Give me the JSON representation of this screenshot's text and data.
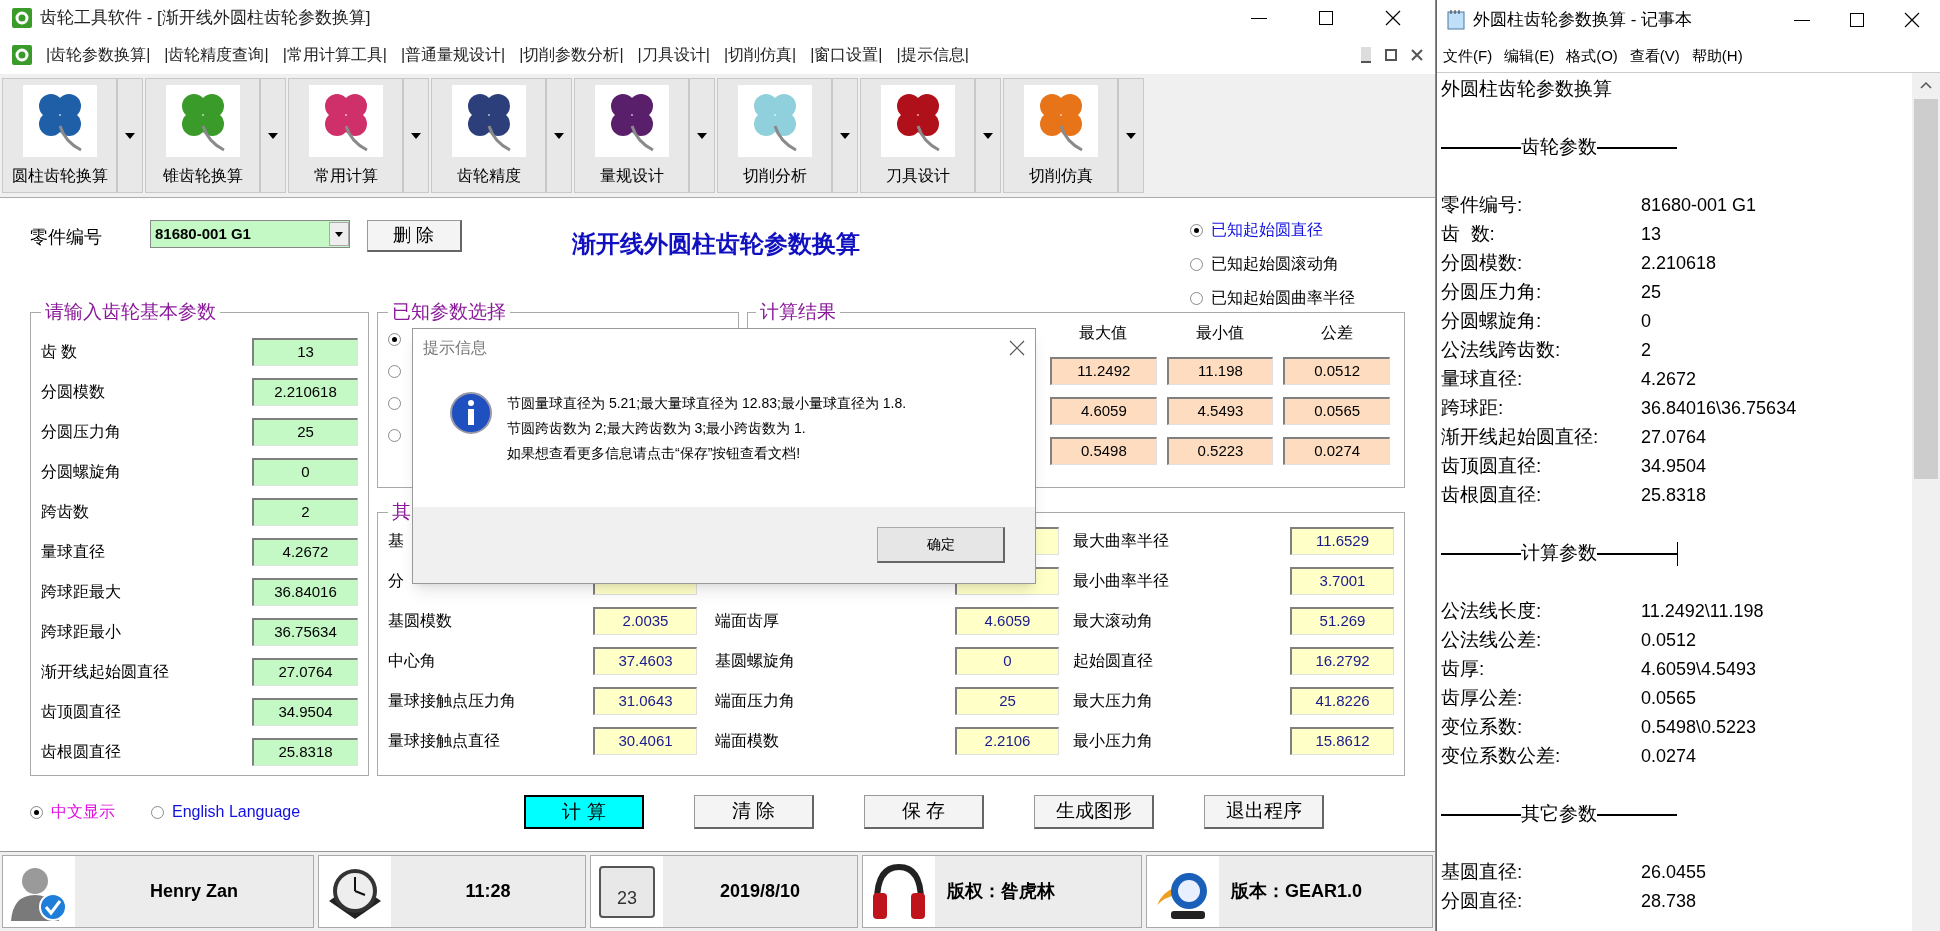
{
  "main_window": {
    "title": "齿轮工具软件 - [渐开线外圆柱齿轮参数换算]"
  },
  "menu": [
    "|齿轮参数换算|",
    "|齿轮精度查询|",
    "|常用计算工具|",
    "|普通量规设计|",
    "|切削参数分析|",
    "|刀具设计|",
    "|切削仿真|",
    "|窗口设置|",
    "|提示信息|"
  ],
  "toolbar": [
    {
      "label": "圆柱齿轮换算",
      "color": "#1f5fa8"
    },
    {
      "label": "锥齿轮换算",
      "color": "#3a9a2a"
    },
    {
      "label": "常用计算",
      "color": "#d0306a"
    },
    {
      "label": "齿轮精度",
      "color": "#2d3f7a"
    },
    {
      "label": "量规设计",
      "color": "#5a1f6a"
    },
    {
      "label": "切削分析",
      "color": "#8fd0dc"
    },
    {
      "label": "刀具设计",
      "color": "#b0101a"
    },
    {
      "label": "切削仿真",
      "color": "#e8741a"
    }
  ],
  "form": {
    "part_no_label": "零件编号",
    "part_no": "81680-001 G1",
    "delete_button": "删 除",
    "title": "渐开线外圆柱齿轮参数换算",
    "modes": [
      {
        "label": "已知起始圆直径",
        "selected": true
      },
      {
        "label": "已知起始圆滚动角",
        "selected": false
      },
      {
        "label": "已知起始圆曲率半径",
        "selected": false
      }
    ]
  },
  "basic": {
    "title": "请输入齿轮基本参数",
    "rows": [
      {
        "label": "齿 数",
        "value": "13"
      },
      {
        "label": "分圆模数",
        "value": "2.210618"
      },
      {
        "label": "分圆压力角",
        "value": "25"
      },
      {
        "label": "分圆螺旋角",
        "value": "0"
      },
      {
        "label": "跨齿数",
        "value": "2"
      },
      {
        "label": "量球直径",
        "value": "4.2672"
      },
      {
        "label": "跨球距最大",
        "value": "36.84016"
      },
      {
        "label": "跨球距最小",
        "value": "36.75634"
      },
      {
        "label": "渐开线起始圆直径",
        "value": "27.0764"
      },
      {
        "label": "齿顶圆直径",
        "value": "34.9504"
      },
      {
        "label": "齿根圆直径",
        "value": "25.8318"
      }
    ]
  },
  "known": {
    "title": "已知参数选择",
    "options": [
      {
        "selected": true
      },
      {
        "selected": false
      },
      {
        "selected": false
      },
      {
        "selected": false
      }
    ]
  },
  "results": {
    "title": "计算结果",
    "columns": [
      "最大值",
      "最小值",
      "公差"
    ],
    "rows": [
      [
        "11.2492",
        "11.198",
        "0.0512"
      ],
      [
        "4.6059",
        "4.5493",
        "0.0565"
      ],
      [
        "0.5498",
        "0.5223",
        "0.0274"
      ]
    ]
  },
  "other": {
    "title": "其",
    "rows": [
      {
        "label_1": "基",
        "label_3": "最大曲率半径",
        "value_3": "11.6529"
      },
      {
        "label_1": "分",
        "label_3": "最小曲率半径",
        "value_3": "3.7001"
      },
      {
        "label_1": "基圆模数",
        "value_1": "2.0035",
        "label_2": "端面齿厚",
        "value_2": "4.6059",
        "label_3": "最大滚动角",
        "value_3": "51.269"
      },
      {
        "label_1": "中心角",
        "value_1": "37.4603",
        "label_2": "基圆螺旋角",
        "value_2": "0",
        "label_3": "起始圆直径",
        "value_3": "16.2792"
      },
      {
        "label_1": "量球接触点压力角",
        "value_1": "31.0643",
        "label_2": "端面压力角",
        "value_2": "25",
        "label_3": "最大压力角",
        "value_3": "41.8226"
      },
      {
        "label_1": "量球接触点直径",
        "value_1": "30.4061",
        "label_2": "端面模数",
        "value_2": "2.2106",
        "label_3": "最小压力角",
        "value_3": "15.8612"
      }
    ]
  },
  "language": [
    {
      "label": "中文显示",
      "selected": true
    },
    {
      "label": "English Language",
      "selected": false
    }
  ],
  "buttons": [
    {
      "label": "计 算",
      "focused": true
    },
    {
      "label": "清 除",
      "focused": false
    },
    {
      "label": "保 存",
      "focused": false
    },
    {
      "label": "生成图形",
      "focused": false
    },
    {
      "label": "退出程序",
      "focused": false
    }
  ],
  "dialog": {
    "title": "提示信息",
    "lines": [
      "节圆量球直径为 5.21;最大量球直径为 12.83;最小量球直径为 1.8.",
      "节圆跨齿数为 2;最大跨齿数为 3;最小跨齿数为 1.",
      "如果想查看更多信息请点击“保存”按钮查看文档!"
    ],
    "ok": "确定"
  },
  "status_bar": [
    {
      "kind": "user",
      "text": "Henry Zan"
    },
    {
      "kind": "clock",
      "text": "11:28"
    },
    {
      "kind": "calendar",
      "icon_text": "23",
      "text": "2019/8/10"
    },
    {
      "kind": "headphones",
      "text": "版权：昝虎林"
    },
    {
      "kind": "globe",
      "text": "版本：GEAR1.0"
    }
  ],
  "notepad": {
    "title": "外圆柱齿轮参数换算 - 记事本",
    "menu": [
      "文件(F)",
      "编辑(E)",
      "格式(O)",
      "查看(V)",
      "帮助(H)"
    ],
    "lines": [
      {
        "kind": "text",
        "text": "外圆柱齿轮参数换算"
      },
      {
        "kind": "blank"
      },
      {
        "kind": "heading",
        "text": "齿轮参数",
        "cursor": false
      },
      {
        "kind": "blank"
      },
      {
        "kind": "pair",
        "label": "零件编号:",
        "value": "81680-001 G1"
      },
      {
        "kind": "pair",
        "label": "齿  数:",
        "value": "13"
      },
      {
        "kind": "pair",
        "label": "分圆模数:",
        "value": "2.210618"
      },
      {
        "kind": "pair",
        "label": "分圆压力角:",
        "value": "25"
      },
      {
        "kind": "pair",
        "label": "分圆螺旋角:",
        "value": "0"
      },
      {
        "kind": "pair",
        "label": "公法线跨齿数:",
        "value": "2"
      },
      {
        "kind": "pair",
        "label": "量球直径:",
        "value": "4.2672"
      },
      {
        "kind": "pair",
        "label": "跨球距:",
        "value": "36.84016\\36.75634"
      },
      {
        "kind": "pair",
        "label": "渐开线起始圆直径:",
        "value": "27.0764"
      },
      {
        "kind": "pair",
        "label": "齿顶圆直径:",
        "value": "34.9504"
      },
      {
        "kind": "pair",
        "label": "齿根圆直径:",
        "value": "25.8318"
      },
      {
        "kind": "blank"
      },
      {
        "kind": "heading",
        "text": "计算参数",
        "cursor": true
      },
      {
        "kind": "blank"
      },
      {
        "kind": "pair",
        "label": "公法线长度:",
        "value": "11.2492\\11.198"
      },
      {
        "kind": "pair",
        "label": "公法线公差:",
        "value": "0.0512"
      },
      {
        "kind": "pair",
        "label": "齿厚:",
        "value": "4.6059\\4.5493"
      },
      {
        "kind": "pair",
        "label": "齿厚公差:",
        "value": "0.0565"
      },
      {
        "kind": "pair",
        "label": "变位系数:",
        "value": "0.5498\\0.5223"
      },
      {
        "kind": "pair",
        "label": "变位系数公差:",
        "value": "0.0274"
      },
      {
        "kind": "blank"
      },
      {
        "kind": "heading",
        "text": "其它参数",
        "cursor": false
      },
      {
        "kind": "blank"
      },
      {
        "kind": "pair",
        "label": "基圆直径:",
        "value": "26.0455"
      },
      {
        "kind": "pair",
        "label": "分圆直径:",
        "value": "28.738"
      }
    ]
  }
}
